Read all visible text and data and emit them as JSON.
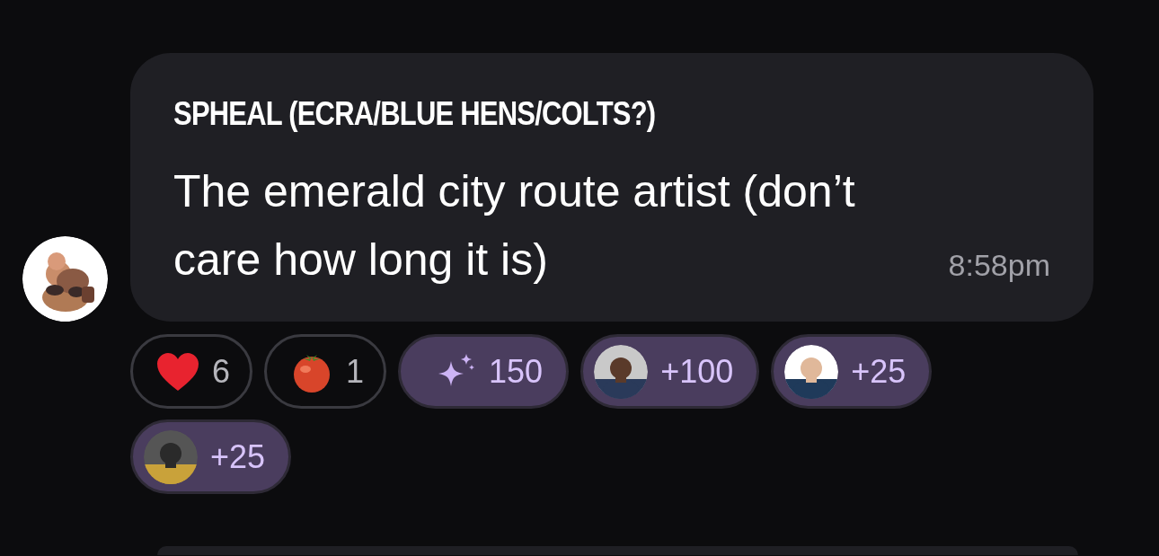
{
  "message": {
    "author": "SPHEAL (ECRA/BLUE HENS/COLTS?)",
    "text": "The emerald city route artist (don’t care how long it is)",
    "time": "8:58pm"
  },
  "reactions": [
    {
      "kind": "heart",
      "count": "6",
      "selected": false
    },
    {
      "kind": "tomato",
      "count": "1",
      "selected": false
    },
    {
      "kind": "sparkle",
      "count": "150",
      "selected": true
    },
    {
      "kind": "picture",
      "count": "+100",
      "selected": true
    },
    {
      "kind": "picture",
      "count": "+25",
      "selected": true
    },
    {
      "kind": "picture",
      "count": "+25",
      "selected": true
    }
  ]
}
